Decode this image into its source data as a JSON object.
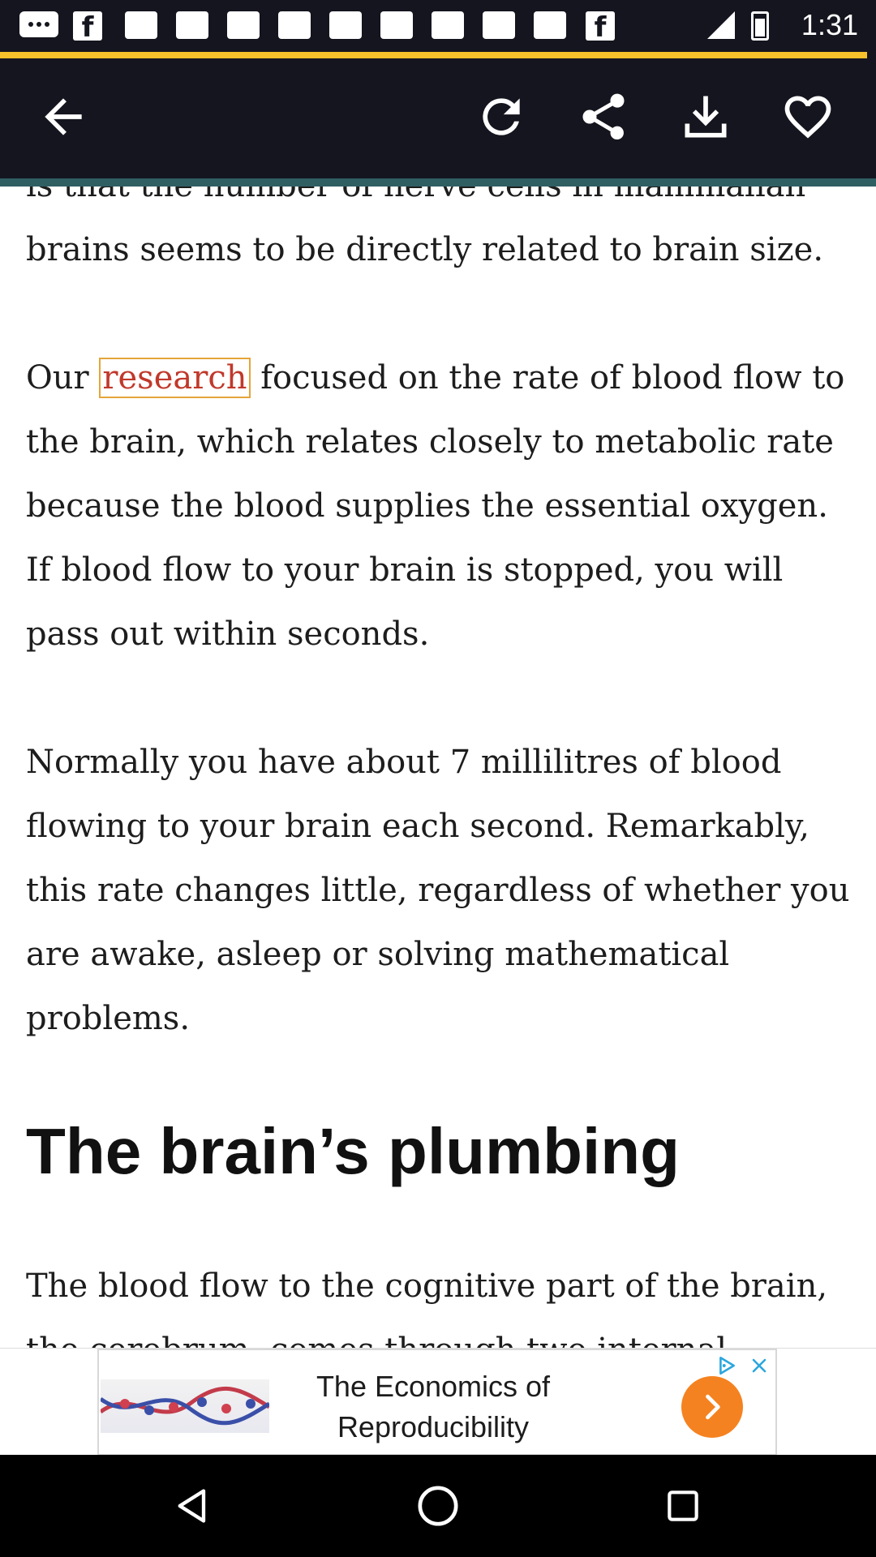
{
  "status_bar": {
    "time": "1:31",
    "notification_icons": [
      "chat-icon",
      "facebook-icon",
      "notification-icon",
      "notification-icon",
      "notification-icon",
      "notification-icon",
      "notification-icon",
      "notification-icon",
      "notification-icon",
      "notification-icon",
      "facebook-icon"
    ],
    "fb_glyph": "f"
  },
  "page_load_progress": 0.99,
  "toolbar": {
    "icons": [
      "back-arrow-icon",
      "refresh-icon",
      "share-icon",
      "download-icon",
      "heart-icon"
    ]
  },
  "article": {
    "line_partial_top": "is that the number of nerve cells in mammalian",
    "para1_rest": "brains seems to be directly related to brain size.",
    "para2_before": "Our ",
    "para2_link": "research",
    "para2_after": " focused on the rate of blood flow to the brain, which relates closely to metabolic rate because the blood supplies the essential oxygen. If blood flow to your brain is stopped, you will pass out within seconds.",
    "para3": "Normally you have about 7 millilitres of blood flowing to your brain each second. Remarkably, this rate changes little, regardless of whether you are awake, asleep or solving mathematical problems.",
    "heading": "The brain’s plumbing",
    "para4_line1": "The blood flow to the cognitive part of the brain,",
    "para4_partial": "the cerebrum, comes through two internal carotid"
  },
  "ad": {
    "title": "The Economics of Reproducibility",
    "icons": [
      "ad-choices-icon",
      "close-icon",
      "chevron-right-icon"
    ],
    "cta_color": "#f58220"
  },
  "navbar": {
    "icons": [
      "back-triangle-icon",
      "home-circle-icon",
      "recents-square-icon"
    ]
  },
  "colors": {
    "toolbar_bg": "#15151f",
    "progress": "#f6c12a",
    "accent": "#2f5e63",
    "link_highlight": "#c0392b"
  }
}
